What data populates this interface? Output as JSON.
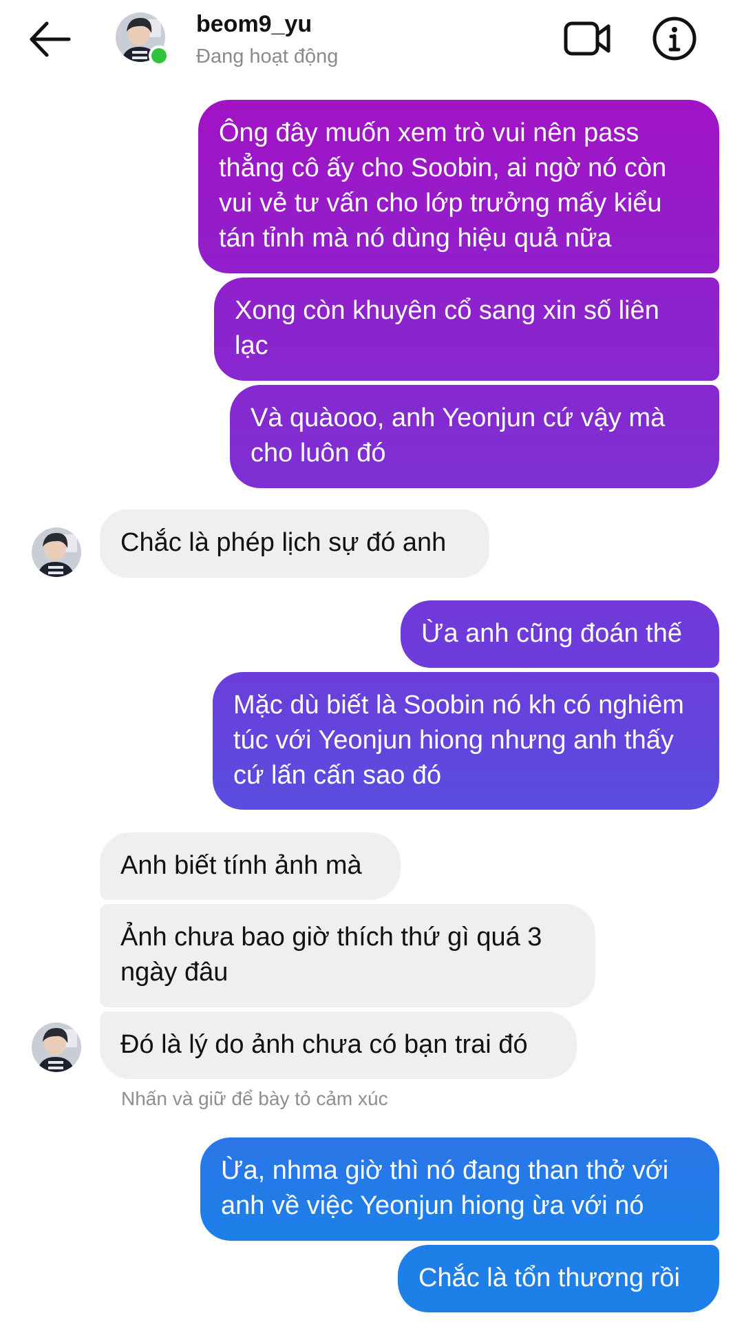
{
  "header": {
    "username": "beom9_yu",
    "status": "Đang hoạt động"
  },
  "messages": [
    {
      "from": "me",
      "text": "Ông đây muốn xem trò vui nên pass thẳng cô ấy cho Soobin, ai ngờ nó còn vui vẻ tư vấn cho lớp trưởng mấy kiểu tán tỉnh mà nó dùng hiệu quả nữa"
    },
    {
      "from": "me",
      "text": "Xong còn khuyên cổ sang xin số liên lạc"
    },
    {
      "from": "me",
      "text": "Và quàooo, anh Yeonjun cứ vậy mà cho luôn đó"
    },
    {
      "from": "them",
      "text": "Chắc là phép lịch sự đó anh"
    },
    {
      "from": "me",
      "text": "Ừa anh cũng đoán thế"
    },
    {
      "from": "me",
      "text": "Mặc dù biết là Soobin nó kh có nghiêm túc với Yeonjun hiong nhưng anh thấy cứ lấn cấn sao đó"
    },
    {
      "from": "them",
      "text": "Anh biết tính ảnh mà"
    },
    {
      "from": "them",
      "text": "Ảnh chưa bao giờ thích thứ gì quá 3 ngày đâu"
    },
    {
      "from": "them",
      "text": "Đó là lý do ảnh chưa có bạn trai đó"
    },
    {
      "from": "me",
      "text": "Ừa, nhma giờ thì nó đang than thở với anh về việc Yeonjun hiong ừa với nó"
    },
    {
      "from": "me",
      "text": "Chắc là tổn thương rồi"
    }
  ],
  "reaction_hint": "Nhấn và giữ để bày tỏ cảm xúc",
  "colors": {
    "gradient_top": "#a212c4",
    "gradient_mid": "#6a3fdc",
    "gradient_bottom": "#1e7fe9",
    "incoming_bg": "#efefef",
    "online": "#31c33b"
  },
  "icons": [
    "back-arrow-icon",
    "video-call-icon",
    "info-icon"
  ]
}
